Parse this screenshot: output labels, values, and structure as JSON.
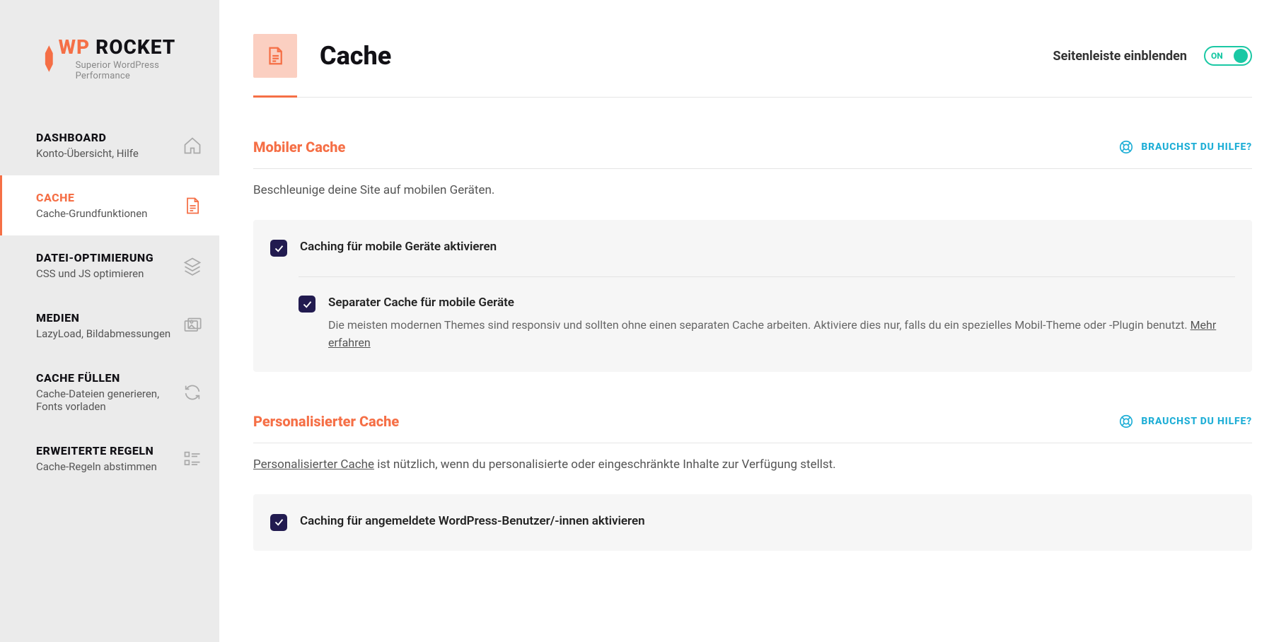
{
  "brand": {
    "wp": "WP",
    "rocket": "ROCKET",
    "tagline": "Superior WordPress Performance"
  },
  "nav": [
    {
      "title": "DASHBOARD",
      "sub": "Konto-Übersicht, Hilfe",
      "icon": "home-icon",
      "active": false
    },
    {
      "title": "CACHE",
      "sub": "Cache-Grundfunktionen",
      "icon": "file-icon",
      "active": true
    },
    {
      "title": "DATEI-OPTIMIERUNG",
      "sub": "CSS und JS optimieren",
      "icon": "layers-icon",
      "active": false
    },
    {
      "title": "MEDIEN",
      "sub": "LazyLoad, Bildabmessungen",
      "icon": "images-icon",
      "active": false
    },
    {
      "title": "CACHE FÜLLEN",
      "sub": "Cache-Dateien generieren, Fonts vorladen",
      "icon": "refresh-icon",
      "active": false
    },
    {
      "title": "ERWEITERTE REGELN",
      "sub": "Cache-Regeln abstimmen",
      "icon": "list-icon",
      "active": false
    }
  ],
  "header": {
    "title": "Cache",
    "sidebarToggleLabel": "Seitenleiste einblenden",
    "toggleState": "ON"
  },
  "sections": {
    "mobile": {
      "title": "Mobiler Cache",
      "helpLabel": "BRAUCHST DU HILFE?",
      "desc": "Beschleunige deine Site auf mobilen Geräten.",
      "opt1": "Caching für mobile Geräte aktivieren",
      "opt2": "Separater Cache für mobile Geräte",
      "opt2help": "Die meisten modernen Themes sind responsiv und sollten ohne einen separaten Cache arbeiten. Aktiviere dies nur, falls du ein spezielles Mobil-Theme oder -Plugin benutzt. ",
      "opt2link": "Mehr erfahren"
    },
    "user": {
      "title": "Personalisierter Cache",
      "helpLabel": "BRAUCHST DU HILFE?",
      "descLink": "Personalisierter Cache",
      "descRest": " ist nützlich, wenn du personalisierte oder eingeschränkte Inhalte zur Verfügung stellst.",
      "opt1": "Caching für angemeldete WordPress-Benutzer/-innen aktivieren"
    }
  }
}
